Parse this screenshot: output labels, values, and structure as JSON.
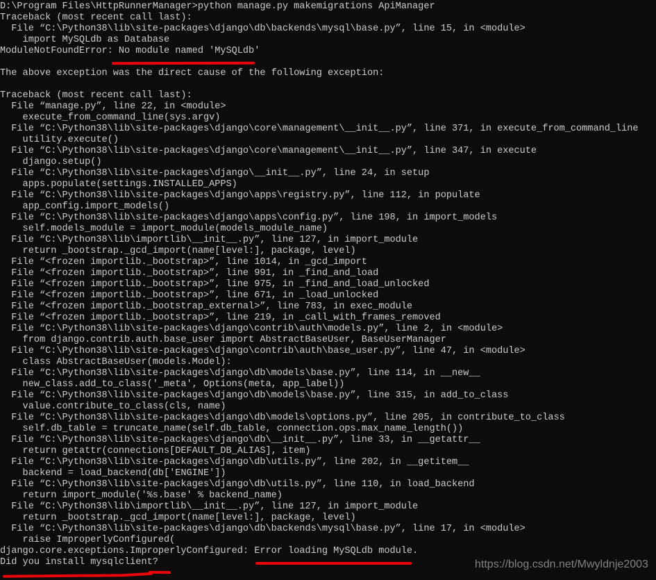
{
  "terminal": {
    "background_color": "#0c0c0c",
    "text_color": "#cccccc",
    "annotation_color": "#e8060a",
    "prompt_path": "D:\\Program Files\\HttpRunnerManager>",
    "command": "python manage.py makemigrations ApiManager",
    "lines": [
      "D:\\Program Files\\HttpRunnerManager>python manage.py makemigrations ApiManager",
      "Traceback (most recent call last):",
      "  File “C:\\Python38\\lib\\site-packages\\django\\db\\backends\\mysql\\base.py”, line 15, in <module>",
      "    import MySQLdb as Database",
      "ModuleNotFoundError: No module named 'MySQLdb'",
      "",
      "The above exception was the direct cause of the following exception:",
      "",
      "Traceback (most recent call last):",
      "  File “manage.py”, line 22, in <module>",
      "    execute_from_command_line(sys.argv)",
      "  File “C:\\Python38\\lib\\site-packages\\django\\core\\management\\__init__.py”, line 371, in execute_from_command_line",
      "    utility.execute()",
      "  File “C:\\Python38\\lib\\site-packages\\django\\core\\management\\__init__.py”, line 347, in execute",
      "    django.setup()",
      "  File “C:\\Python38\\lib\\site-packages\\django\\__init__.py”, line 24, in setup",
      "    apps.populate(settings.INSTALLED_APPS)",
      "  File “C:\\Python38\\lib\\site-packages\\django\\apps\\registry.py”, line 112, in populate",
      "    app_config.import_models()",
      "  File “C:\\Python38\\lib\\site-packages\\django\\apps\\config.py”, line 198, in import_models",
      "    self.models_module = import_module(models_module_name)",
      "  File “C:\\Python38\\lib\\importlib\\__init__.py”, line 127, in import_module",
      "    return _bootstrap._gcd_import(name[level:], package, level)",
      "  File “<frozen importlib._bootstrap>”, line 1014, in _gcd_import",
      "  File “<frozen importlib._bootstrap>”, line 991, in _find_and_load",
      "  File “<frozen importlib._bootstrap>”, line 975, in _find_and_load_unlocked",
      "  File “<frozen importlib._bootstrap>”, line 671, in _load_unlocked",
      "  File “<frozen importlib._bootstrap_external>”, line 783, in exec_module",
      "  File “<frozen importlib._bootstrap>”, line 219, in _call_with_frames_removed",
      "  File “C:\\Python38\\lib\\site-packages\\django\\contrib\\auth\\models.py”, line 2, in <module>",
      "    from django.contrib.auth.base_user import AbstractBaseUser, BaseUserManager",
      "  File “C:\\Python38\\lib\\site-packages\\django\\contrib\\auth\\base_user.py”, line 47, in <module>",
      "    class AbstractBaseUser(models.Model):",
      "  File “C:\\Python38\\lib\\site-packages\\django\\db\\models\\base.py”, line 114, in __new__",
      "    new_class.add_to_class('_meta', Options(meta, app_label))",
      "  File “C:\\Python38\\lib\\site-packages\\django\\db\\models\\base.py”, line 315, in add_to_class",
      "    value.contribute_to_class(cls, name)",
      "  File “C:\\Python38\\lib\\site-packages\\django\\db\\models\\options.py”, line 205, in contribute_to_class",
      "    self.db_table = truncate_name(self.db_table, connection.ops.max_name_length())",
      "  File “C:\\Python38\\lib\\site-packages\\django\\db\\__init__.py”, line 33, in __getattr__",
      "    return getattr(connections[DEFAULT_DB_ALIAS], item)",
      "  File “C:\\Python38\\lib\\site-packages\\django\\db\\utils.py”, line 202, in __getitem__",
      "    backend = load_backend(db['ENGINE'])",
      "  File “C:\\Python38\\lib\\site-packages\\django\\db\\utils.py”, line 110, in load_backend",
      "    return import_module('%s.base' % backend_name)",
      "  File “C:\\Python38\\lib\\importlib\\__init__.py”, line 127, in import_module",
      "    return _bootstrap._gcd_import(name[level:], package, level)",
      "  File “C:\\Python38\\lib\\site-packages\\django\\db\\backends\\mysql\\base.py”, line 17, in <module>",
      "    raise ImproperlyConfigured(",
      "django.core.exceptions.ImproperlyConfigured: Error loading MySQLdb module.",
      "Did you install mysqlclient?"
    ],
    "first_error": "ModuleNotFoundError: No module named 'MySQLdb'",
    "final_error": "django.core.exceptions.ImproperlyConfigured: Error loading MySQLdb module.",
    "final_hint": "Did you install mysqlclient?",
    "annotations": [
      {
        "name": "underline-no-module-named-mysqldb",
        "target": "No module named 'MySQLdb'"
      },
      {
        "name": "underline-error-loading-mysqldb-module",
        "target": "Error loading MySQLdb module."
      },
      {
        "name": "underline-did-you-install-mysqlclient",
        "target": "Did you install mysqlclient?"
      }
    ]
  },
  "watermark": {
    "text": "https://blog.csdn.net/Mwyldnje2003"
  }
}
